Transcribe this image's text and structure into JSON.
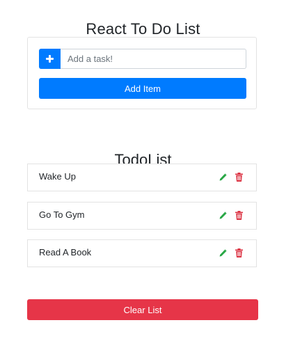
{
  "app": {
    "title": "React To Do List"
  },
  "input": {
    "placeholder": "Add a task!",
    "value": "",
    "add_icon": "plus-icon",
    "add_item_label": "Add Item"
  },
  "todo_list": {
    "title": "TodoList",
    "items": [
      {
        "text": "Wake Up"
      },
      {
        "text": "Go To Gym"
      },
      {
        "text": "Read A Book"
      }
    ],
    "edit_icon": "pencil-icon",
    "delete_icon": "trash-icon"
  },
  "clear_button": {
    "label": "Clear List"
  },
  "colors": {
    "primary": "#007bff",
    "danger": "#e63548",
    "edit_icon": "#28a745",
    "delete_icon": "#dc3545"
  }
}
